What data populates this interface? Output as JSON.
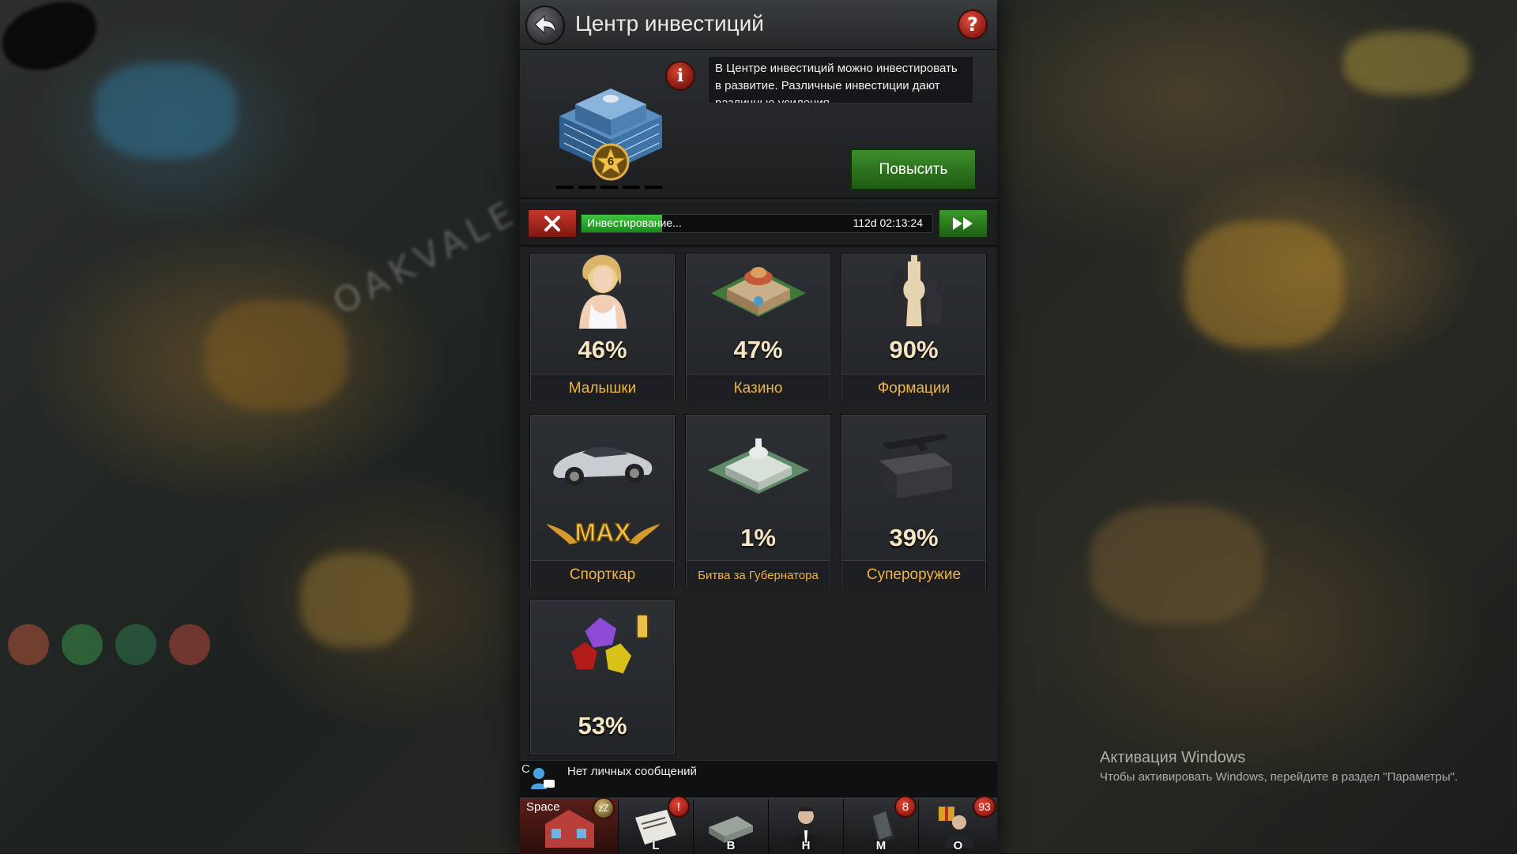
{
  "window": {
    "title": "Центр инвестиций"
  },
  "header": {
    "building_level": "6",
    "description": "В Центре инвестиций можно инвестировать в развитие. Различные инвестиции дают различные усиления",
    "upgrade_label": "Повысить"
  },
  "progress": {
    "label": "Инвестирование...",
    "time_left": "112d 02:13:24",
    "fraction": 0.23
  },
  "investments": [
    {
      "percent": "46%",
      "label": "Малышки",
      "icon": "girl-icon"
    },
    {
      "percent": "47%",
      "label": "Казино",
      "icon": "casino-icon"
    },
    {
      "percent": "90%",
      "label": "Формации",
      "icon": "chess-icon"
    },
    {
      "percent": "MAX",
      "label": "Спорткар",
      "icon": "sportscar-icon"
    },
    {
      "percent": "1%",
      "label": "Битва за Губернатора",
      "icon": "capitol-icon"
    },
    {
      "percent": "39%",
      "label": "Супероружие",
      "icon": "weapon-crate-icon"
    },
    {
      "percent": "53%",
      "label": "",
      "icon": "gems-icon"
    }
  ],
  "chat": {
    "prefix": "С",
    "message": "Нет личных сообщений"
  },
  "bottom_tabs": [
    {
      "key": "Space",
      "badge": "zZ"
    },
    {
      "key": "L",
      "badge": "!"
    },
    {
      "key": "B",
      "badge": ""
    },
    {
      "key": "H",
      "badge": ""
    },
    {
      "key": "M",
      "badge": "8"
    },
    {
      "key": "O",
      "badge": "93"
    }
  ],
  "background": {
    "city_label": "OAKVALE"
  },
  "windows_notice": {
    "title": "Активация Windows",
    "text": "Чтобы активировать Windows, перейдите в раздел \"Параметры\"."
  },
  "colors": {
    "accent_gold": "#f0b446",
    "progress_green": "#2fb12f",
    "button_green": "#2e7a20",
    "button_red": "#b32a1f"
  }
}
